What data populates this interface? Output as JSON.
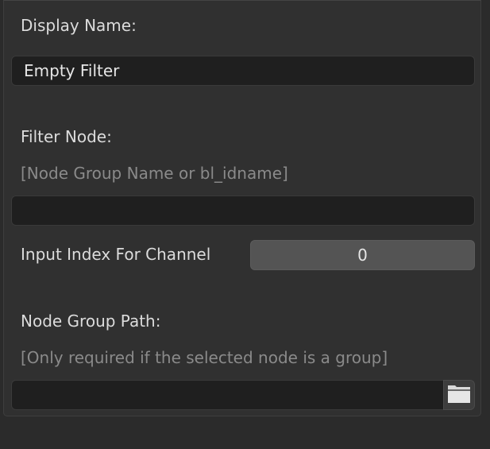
{
  "display_name": {
    "label": "Display Name:",
    "value": "Empty Filter"
  },
  "filter_node": {
    "label": "Filter Node:",
    "hint": "[Node Group Name or bl_idname]",
    "value": ""
  },
  "input_index": {
    "label": "Input Index For Channel",
    "value": "0"
  },
  "node_group_path": {
    "label": "Node Group Path:",
    "hint": "[Only required if the selected node is a group]",
    "value": "",
    "browse_icon": "folder-icon"
  }
}
